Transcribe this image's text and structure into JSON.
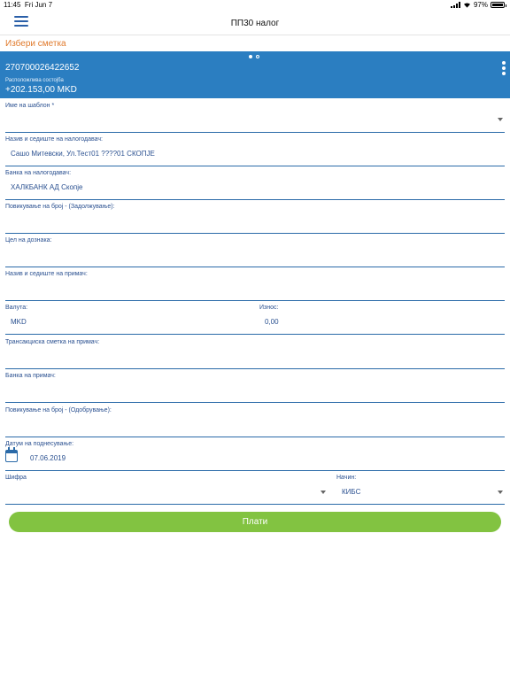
{
  "status_bar": {
    "time": "11:45",
    "date": "Fri Jun 7",
    "battery": "97%",
    "battery_level": 0.97
  },
  "nav": {
    "title": "ПП30 налог",
    "menu_icon": "hamburger-menu-icon"
  },
  "select_account_label": "Избери сметка",
  "account": {
    "number": "270700026422652",
    "balance_label": "Расположлива состојба",
    "balance": "+202.153,00 MKD",
    "pages": 2,
    "active_page": 1
  },
  "fields": {
    "template_name": {
      "label": "Име на шаблон *",
      "value": ""
    },
    "payer_name": {
      "label": "Назив и седиште на налогодавач:",
      "value": "Сашо Митевски, Ул.Тест01 ????01 СКОПЈЕ"
    },
    "payer_bank": {
      "label": "Банка на налогодавач:",
      "value": "ХАЛКБАНК АД Скопје"
    },
    "debit_reference": {
      "label": "Повикување на број - (Задолжување):",
      "value": ""
    },
    "purpose": {
      "label": "Цел на дознака:",
      "value": ""
    },
    "recipient_name": {
      "label": "Назив и седиште на примач:",
      "value": ""
    },
    "currency": {
      "label": "Валута:",
      "value": "MKD"
    },
    "amount": {
      "label": "Износ:",
      "value": "0,00"
    },
    "recipient_account": {
      "label": "Трансакциска сметка на примач:",
      "value": ""
    },
    "recipient_bank": {
      "label": "Банка на примач:",
      "value": ""
    },
    "credit_reference": {
      "label": "Повикување на број - (Одобрување):",
      "value": ""
    },
    "submit_date": {
      "label": "Датум на поднесување:",
      "value": "07.06.2019"
    },
    "code": {
      "label": "Шифра",
      "value": ""
    },
    "method": {
      "label": "Начин:",
      "value": "КИБС"
    }
  },
  "pay_button": "Плати",
  "colors": {
    "accent_blue": "#2b7ec1",
    "orange": "#e07a2c",
    "pay_green": "#82c341",
    "field_text": "#2a5090"
  }
}
